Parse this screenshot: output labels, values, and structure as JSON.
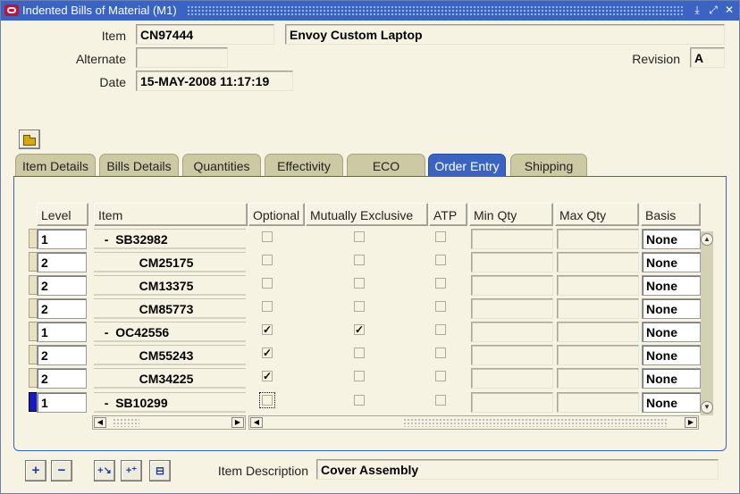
{
  "window": {
    "title": "Indented Bills of Material (M1)"
  },
  "header": {
    "item_label": "Item",
    "item_value": "CN97444",
    "item_name": "Envoy Custom Laptop",
    "alternate_label": "Alternate",
    "alternate_value": "",
    "revision_label": "Revision",
    "revision_value": "A",
    "date_label": "Date",
    "date_value": "15-MAY-2008 11:17:19"
  },
  "tabs": [
    {
      "label": "Item Details",
      "active": false
    },
    {
      "label": "Bills Details",
      "active": false
    },
    {
      "label": "Quantities",
      "active": false
    },
    {
      "label": "Effectivity",
      "active": false
    },
    {
      "label": "ECO",
      "active": false
    },
    {
      "label": "Order Entry",
      "active": true
    },
    {
      "label": "Shipping",
      "active": false
    }
  ],
  "table": {
    "columns": {
      "level": "Level",
      "item": "Item",
      "optional": "Optional",
      "mutually_exclusive": "Mutually Exclusive",
      "atp": "ATP",
      "min_qty": "Min Qty",
      "max_qty": "Max Qty",
      "basis": "Basis"
    },
    "rows": [
      {
        "level": "1",
        "item": "  -  SB32982",
        "optional": false,
        "mutually_exclusive": false,
        "atp": false,
        "basis": "None"
      },
      {
        "level": "2",
        "item": "            CM25175",
        "optional": false,
        "mutually_exclusive": false,
        "atp": false,
        "basis": "None"
      },
      {
        "level": "2",
        "item": "            CM13375",
        "optional": false,
        "mutually_exclusive": false,
        "atp": false,
        "basis": "None"
      },
      {
        "level": "2",
        "item": "            CM85773",
        "optional": false,
        "mutually_exclusive": false,
        "atp": false,
        "basis": "None"
      },
      {
        "level": "1",
        "item": "  -  OC42556",
        "optional": true,
        "mutually_exclusive": true,
        "atp": false,
        "basis": "None"
      },
      {
        "level": "2",
        "item": "            CM55243",
        "optional": true,
        "mutually_exclusive": false,
        "atp": false,
        "basis": "None"
      },
      {
        "level": "2",
        "item": "            CM34225",
        "optional": true,
        "mutually_exclusive": false,
        "atp": false,
        "basis": "None"
      },
      {
        "level": "1",
        "item": "  -  SB10299",
        "optional": false,
        "mutually_exclusive": false,
        "atp": false,
        "basis": "None"
      }
    ]
  },
  "footer": {
    "description_label": "Item Description",
    "description_value": "Cover Assembly"
  },
  "icons": {
    "open": "folder-open-icon",
    "expand": "plus-icon",
    "collapse": "minus-icon",
    "expand_branch": "expand-branch-icon",
    "expand_all": "expand-all-icon",
    "collapse_all": "collapse-all-icon"
  },
  "colors": {
    "titlebar": "#3a64c4",
    "form_bg": "#f7f3e3",
    "tab": "#cdc9a3",
    "tab_active": "#3a64c4"
  }
}
